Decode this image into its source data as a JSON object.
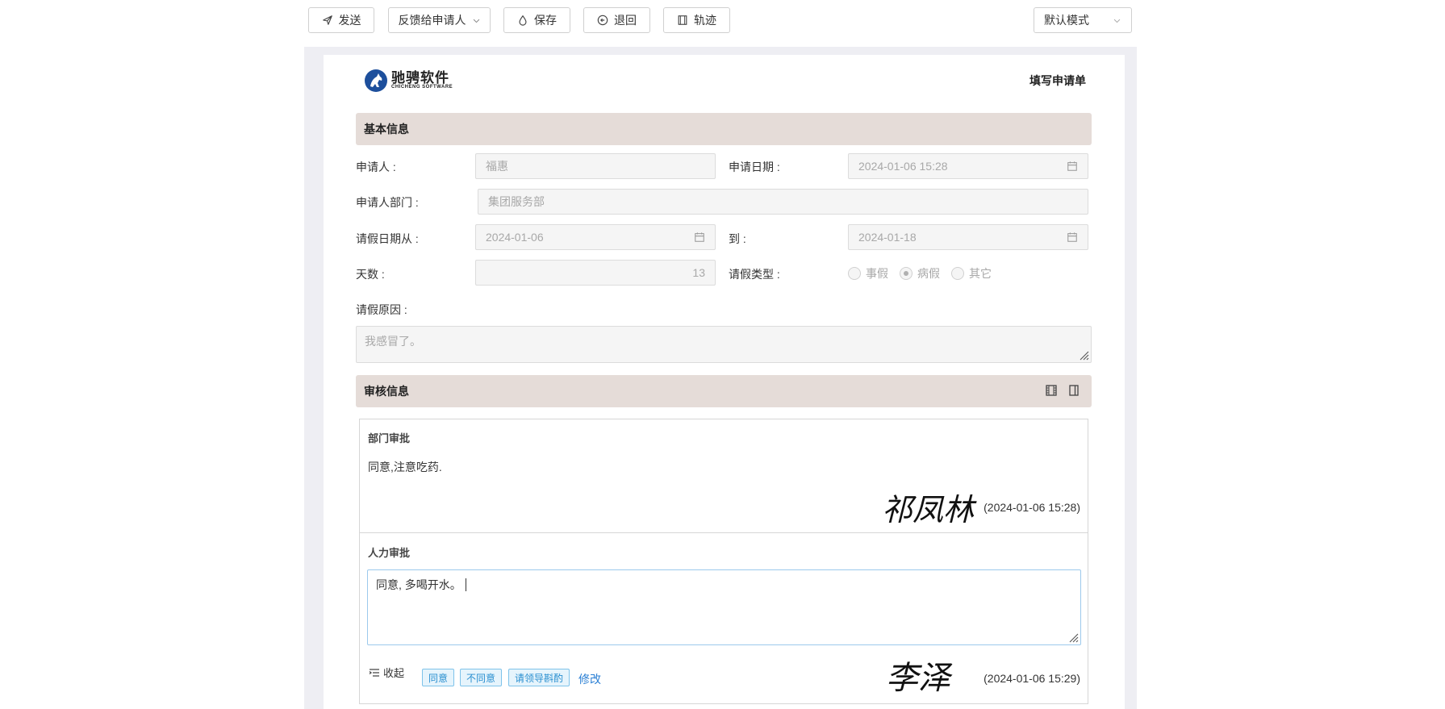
{
  "toolbar": {
    "send": "发送",
    "feedback": "反馈给申请人",
    "save": "保存",
    "return": "退回",
    "track": "轨迹",
    "mode": "默认模式"
  },
  "header": {
    "logo_cn": "驰骋软件",
    "logo_en": "CHICHENG SOFTWARE",
    "form_title": "填写申请单"
  },
  "basic": {
    "section_title": "基本信息",
    "applicant_label": "申请人 :",
    "applicant_value": "福惠",
    "apply_date_label": "申请日期 :",
    "apply_date_value": "2024-01-06 15:28",
    "dept_label": "申请人部门 :",
    "dept_value": "集团服务部",
    "leave_from_label": "请假日期从 :",
    "leave_from_value": "2024-01-06",
    "to_label": "到 :",
    "to_value": "2024-01-18",
    "days_label": "天数 :",
    "days_value": "13",
    "type_label": "请假类型 :",
    "type_options": [
      "事假",
      "病假",
      "其它"
    ],
    "type_selected": "病假",
    "reason_label": "请假原因 :",
    "reason_value": "我感冒了。"
  },
  "review": {
    "section_title": "审核信息",
    "dept": {
      "title": "部门审批",
      "opinion": "同意,注意吃药.",
      "signature": "祁凤林",
      "time": "(2024-01-06 15:28)"
    },
    "hr": {
      "title": "人力审批",
      "opinion": "同意, 多喝开水。",
      "collapse": "收起",
      "tags": [
        "同意",
        "不同意",
        "请领导斟酌"
      ],
      "edit": "修改",
      "signature": "李泽",
      "time": "(2024-01-06 15:29)"
    }
  }
}
